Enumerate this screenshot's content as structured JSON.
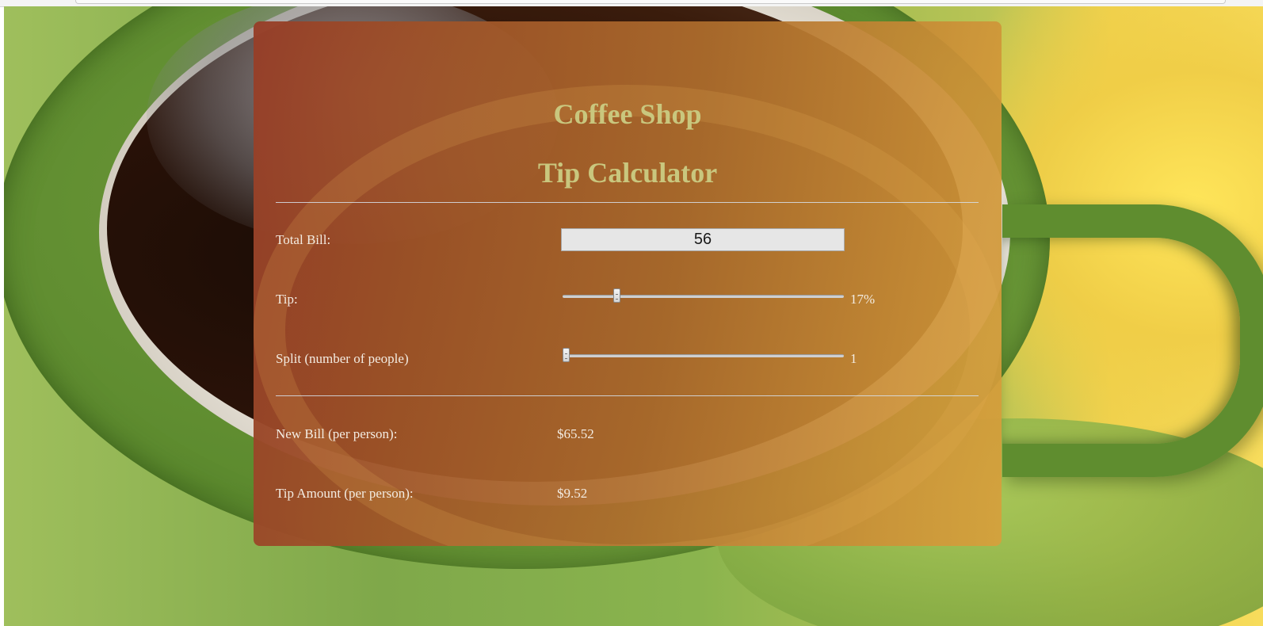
{
  "app": {
    "title_line1": "Coffee Shop",
    "title_line2": "Tip Calculator"
  },
  "form": {
    "total_bill_label": "Total Bill:",
    "total_bill_value": "56",
    "tip_label": "Tip:",
    "tip_percent": 17,
    "tip_display": "17%",
    "tip_slider_fraction": 0.185,
    "split_label": "Split (number of people)",
    "split_value": 1,
    "split_display": "1",
    "split_slider_fraction": 0.0
  },
  "results": {
    "new_bill_label": "New Bill (per person):",
    "new_bill_value": "$65.52",
    "tip_amount_label": "Tip Amount (per person):",
    "tip_amount_value": "$9.52"
  },
  "colors": {
    "title": "#c9c77e",
    "card_start": "#963e28",
    "card_end": "#d7a03c",
    "text": "#f3ece2"
  }
}
